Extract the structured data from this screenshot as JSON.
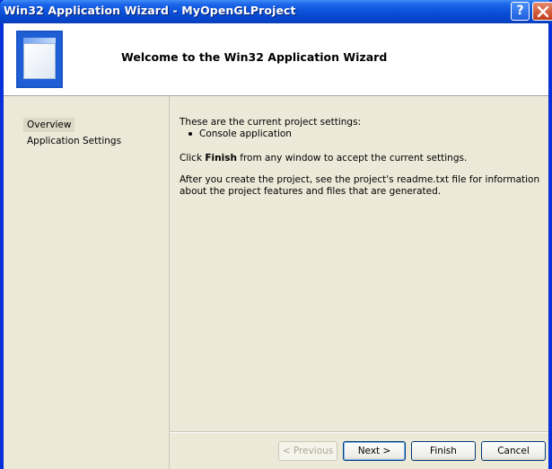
{
  "window": {
    "title": "Win32 Application Wizard - MyOpenGLProject",
    "help_label": "?"
  },
  "header": {
    "title": "Welcome to the Win32 Application Wizard"
  },
  "sidebar": {
    "items": [
      {
        "label": "Overview",
        "selected": true
      },
      {
        "label": "Application Settings",
        "selected": false
      }
    ]
  },
  "content": {
    "intro": "These are the current project settings:",
    "settings": [
      "Console application"
    ],
    "finish_prefix": "Click ",
    "finish_bold": "Finish",
    "finish_suffix": " from any window to accept the current settings.",
    "readme_note": "After you create the project, see the project's readme.txt file for information about the project features and files that are generated."
  },
  "buttons": {
    "previous": "< Previous",
    "next": "Next >",
    "finish": "Finish",
    "cancel": "Cancel",
    "previous_enabled": false
  },
  "colors": {
    "titlebar": "#0a4fd6",
    "window_bg": "#ece9d8",
    "header_bg": "#ffffff"
  }
}
